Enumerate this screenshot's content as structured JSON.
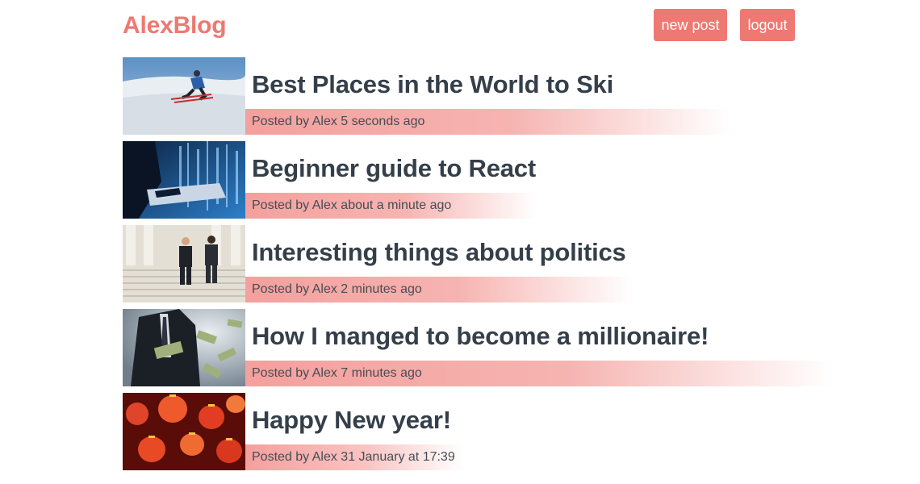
{
  "header": {
    "brand": "AlexBlog",
    "new_post_label": "new post",
    "logout_label": "logout"
  },
  "colors": {
    "accent": "#ee7872",
    "title_text": "#353f4a",
    "meta_gradient_start": "#f4a09d"
  },
  "posts": [
    {
      "title": "Best Places in the World to Ski",
      "meta": "Posted by Alex 5 seconds ago",
      "image": "skier-image"
    },
    {
      "title": "Beginner guide to React",
      "meta": "Posted by Alex about a minute ago",
      "image": "laptop-data-image"
    },
    {
      "title": "Interesting things about politics",
      "meta": "Posted by Alex 2 minutes ago",
      "image": "politicians-image"
    },
    {
      "title": "How I manged to become a millionaire!",
      "meta": "Posted by Alex 7 minutes ago",
      "image": "money-image"
    },
    {
      "title": "Happy New year!",
      "meta": "Posted by Alex 31 January at 17:39",
      "image": "lanterns-image"
    }
  ]
}
